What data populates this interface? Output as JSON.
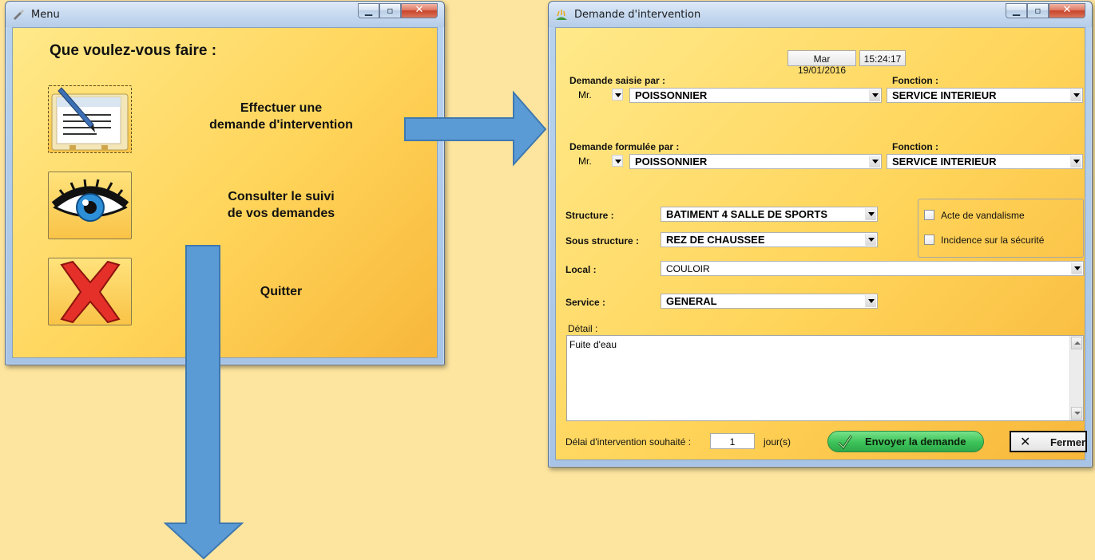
{
  "menu_window": {
    "title": "Menu",
    "heading": "Que voulez-vous faire :",
    "options": [
      {
        "line1": "Effectuer une",
        "line2": "demande d'intervention",
        "icon": "document-pen-icon"
      },
      {
        "line1": "Consulter le suivi",
        "line2": "de vos demandes",
        "icon": "eye-icon"
      },
      {
        "line1": "Quitter",
        "line2": "",
        "icon": "red-x-icon"
      }
    ]
  },
  "form_window": {
    "title": "Demande d'intervention",
    "date": "Mar 19/01/2016",
    "time": "15:24:17",
    "saisie": {
      "label": "Demande saisie par :",
      "civilite": "Mr.",
      "nom": "POISSONNIER",
      "fonction_label": "Fonction :",
      "fonction": "SERVICE INTERIEUR"
    },
    "formulee": {
      "label": "Demande formulée par :",
      "civilite": "Mr.",
      "nom": "POISSONNIER",
      "fonction_label": "Fonction :",
      "fonction": "SERVICE INTERIEUR"
    },
    "structure": {
      "label": "Structure :",
      "value": "BATIMENT 4 SALLE DE SPORTS"
    },
    "sous_structure": {
      "label": "Sous structure :",
      "value": "REZ DE CHAUSSEE"
    },
    "local": {
      "label": "Local :",
      "value": "COULOIR"
    },
    "service": {
      "label": "Service :",
      "value": "GENERAL"
    },
    "checkboxes": {
      "vandalisme": "Acte de vandalisme",
      "securite": "Incidence sur la sécurité"
    },
    "detail": {
      "label": "Détail :",
      "value": "Fuite d'eau"
    },
    "delai": {
      "label": "Délai d'intervention souhaité :",
      "value": "1",
      "unit": "jour(s)"
    },
    "send_label": "Envoyer la demande",
    "close_label": "Fermer"
  },
  "colors": {
    "background": "#fde59f",
    "arrow": "#5b9bd5",
    "arrow_border": "#3f78b0"
  }
}
